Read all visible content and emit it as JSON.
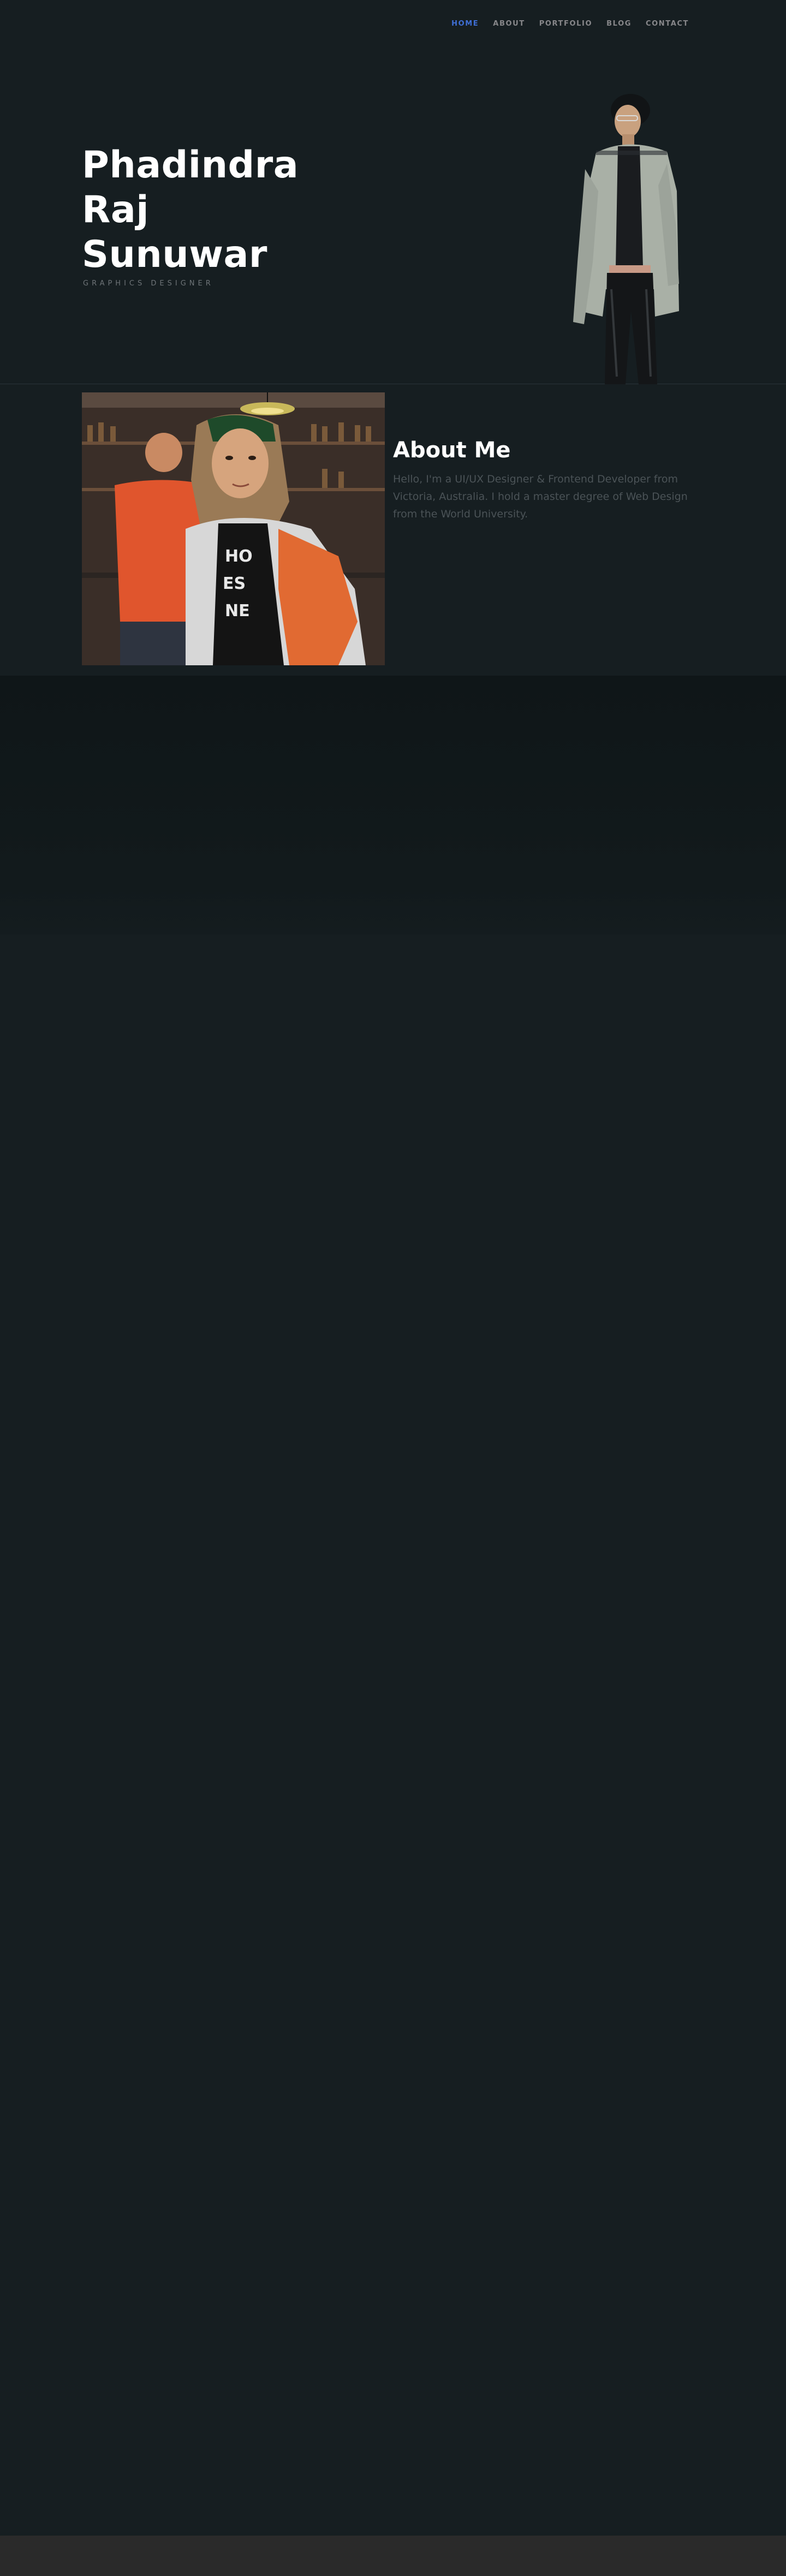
{
  "nav": {
    "items": [
      {
        "label": "HOME",
        "active": true
      },
      {
        "label": "ABOUT",
        "active": false
      },
      {
        "label": "PORTFOLIO",
        "active": false
      },
      {
        "label": "BLOG",
        "active": false
      },
      {
        "label": "CONTACT",
        "active": false
      }
    ]
  },
  "hero": {
    "title_lines": [
      "Phadindra",
      "Raj",
      "Sunuwar"
    ],
    "subtitle": "GRAPHICS DESIGNER"
  },
  "about": {
    "heading": "About Me",
    "text": "Hello, I'm a UI/UX Designer & Frontend Developer from Victoria, Australia. I hold a master degree of Web Design from the World University."
  },
  "colors": {
    "background": "#161e21",
    "accent": "#3f6fd6",
    "nav_text": "#87878a",
    "muted_text": "#4b5357",
    "footer": "#2a2a2a"
  }
}
